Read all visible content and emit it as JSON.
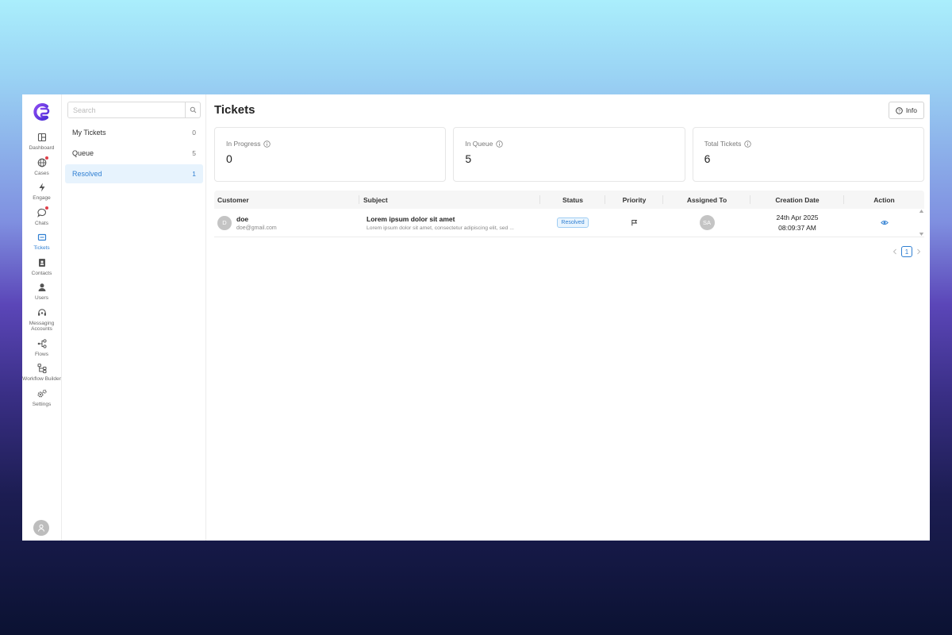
{
  "nav": {
    "items": [
      {
        "label": "Dashboard",
        "icon": "dashboard-icon"
      },
      {
        "label": "Cases",
        "icon": "globe-icon",
        "dot": true
      },
      {
        "label": "Engage",
        "icon": "lightning-icon"
      },
      {
        "label": "Chats",
        "icon": "chat-bubble-icon",
        "dot": true
      },
      {
        "label": "Tickets",
        "icon": "ticket-icon",
        "active": true
      },
      {
        "label": "Contacts",
        "icon": "contact-card-icon"
      },
      {
        "label": "Users",
        "icon": "user-icon"
      },
      {
        "label": "Messaging Accounts",
        "icon": "headset-icon"
      },
      {
        "label": "Flows",
        "icon": "flow-icon"
      },
      {
        "label": "Workflow Builder",
        "icon": "workflow-icon"
      },
      {
        "label": "Settings",
        "icon": "gears-icon"
      }
    ]
  },
  "sidebar": {
    "search_placeholder": "Search",
    "items": [
      {
        "label": "My Tickets",
        "count": "0"
      },
      {
        "label": "Queue",
        "count": "5"
      },
      {
        "label": "Resolved",
        "count": "1",
        "active": true
      }
    ]
  },
  "header": {
    "title": "Tickets",
    "info_label": "Info"
  },
  "stats": [
    {
      "label": "In Progress",
      "value": "0"
    },
    {
      "label": "In Queue",
      "value": "5"
    },
    {
      "label": "Total Tickets",
      "value": "6"
    }
  ],
  "table": {
    "columns": [
      "Customer",
      "Subject",
      "Status",
      "Priority",
      "Assigned To",
      "Creation Date",
      "Action"
    ],
    "rows": [
      {
        "customer_initial": "D",
        "customer_name": "doe",
        "customer_email": "doe@gmail.com",
        "subject_title": "Lorem ipsum dolor sit amet",
        "subject_desc": "Lorem ipsum dolor sit amet, consectetur adipiscing elit, sed ...",
        "status": "Resolved",
        "priority_icon": "flag-icon",
        "assignee_initials": "SA",
        "date": "24th Apr 2025",
        "time": "08:09:37 AM",
        "action_icon": "eye-icon"
      }
    ]
  },
  "pagination": {
    "current": "1"
  },
  "colors": {
    "accent": "#2f7fd2",
    "brand": "#6b3de0",
    "alert_dot": "#e0404a"
  }
}
